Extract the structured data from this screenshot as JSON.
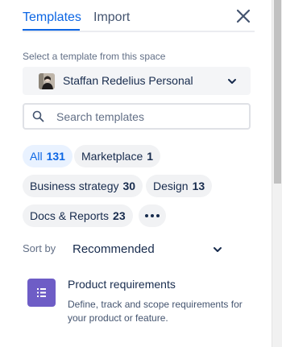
{
  "tabs": [
    {
      "label": "Templates",
      "active": true
    },
    {
      "label": "Import",
      "active": false
    }
  ],
  "close_icon": "close-icon",
  "space": {
    "label": "Select a template from this space",
    "selected": "Staffan Redelius Personal"
  },
  "search": {
    "placeholder": "Search templates",
    "value": ""
  },
  "filters": [
    {
      "label": "All",
      "count": "131",
      "selected": true
    },
    {
      "label": "Marketplace",
      "count": "1",
      "selected": false
    },
    {
      "label": "Business strategy",
      "count": "30",
      "selected": false
    },
    {
      "label": "Design",
      "count": "13",
      "selected": false
    },
    {
      "label": "Docs & Reports",
      "count": "23",
      "selected": false
    }
  ],
  "sort": {
    "label": "Sort by",
    "value": "Recommended"
  },
  "templates": [
    {
      "title": "Product requirements",
      "description": "Define, track and scope requirements for your product or feature.",
      "icon": "list-icon",
      "icon_color": "#6e5dc6"
    }
  ],
  "colors": {
    "accent": "#0c66e4",
    "selected_chip_bg": "#e9f2ff",
    "chip_bg": "#f1f2f4"
  }
}
